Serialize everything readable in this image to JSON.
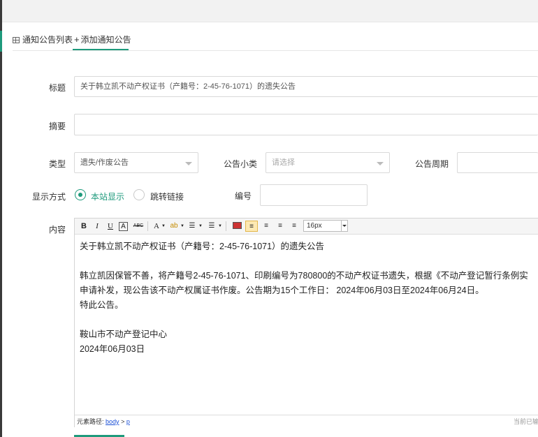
{
  "tabs": {
    "list_label": "通知公告列表",
    "add_label": "添加通知公告"
  },
  "form": {
    "title_label": "标题",
    "title_value": "关于韩立凯不动产权证书（产籍号：2-45-76-1071）的遗失公告",
    "summary_label": "摘要",
    "summary_value": "",
    "type_label": "类型",
    "type_value": "遗失/作废公告",
    "subtype_label": "公告小类",
    "subtype_placeholder": "请选择",
    "period_label": "公告周期",
    "period_value": "",
    "display_label": "显示方式",
    "display_options": [
      "本站显示",
      "跳转链接"
    ],
    "display_selected": "本站显示",
    "number_label": "编号",
    "number_value": "",
    "content_label": "内容"
  },
  "editor": {
    "toolbar": {
      "bold": "B",
      "italic": "I",
      "underline": "U",
      "font_color": "A",
      "strike": "ABC",
      "text_color": "A",
      "font_size": "16px"
    },
    "content_lines": [
      "关于韩立凯不动产权证书（产籍号：2-45-76-1071）的遗失公告",
      "",
      "韩立凯因保管不善，将产籍号2-45-76-1071、印刷编号为780800的不动产权证书遗失，根据《不动产登记暂行条例实",
      "申请补发，现公告该不动产权属证书作废。公告期为15个工作日： 2024年06月03日至2024年06月24日。",
      "特此公告。",
      "",
      "鞍山市不动产登记中心",
      "2024年06月03日"
    ],
    "status_path_label": "元素路径:",
    "status_path_body": "body",
    "status_path_sep": ">",
    "status_path_p": "p",
    "status_right": "当前已输"
  },
  "colors": {
    "accent": "#1e9a7c",
    "link": "#1a4fd6"
  }
}
